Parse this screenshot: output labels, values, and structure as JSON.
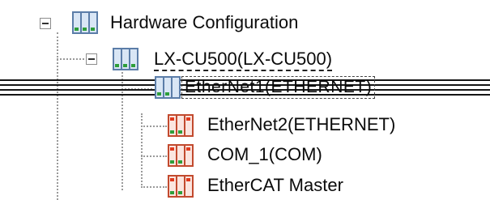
{
  "tree": {
    "root": {
      "label": "Hardware Configuration",
      "icon": "hardware-config-icon",
      "expanded": true
    },
    "controller": {
      "label": "LX-CU500(LX-CU500)",
      "icon": "controller-icon",
      "expanded": true
    },
    "children": [
      {
        "label": "EtherNet1(ETHERNET)",
        "icon": "ethernet-module-icon",
        "selected": true
      },
      {
        "label": "EtherNet2(ETHERNET)",
        "icon": "ethernet-module-icon"
      },
      {
        "label": "COM_1(COM)",
        "icon": "com-port-icon"
      },
      {
        "label": "EtherCAT Master",
        "icon": "ethercat-master-icon"
      }
    ]
  },
  "colors": {
    "icon_frame": "#5b7da8",
    "icon_fill": "#d9e6f5",
    "status_green": "#2e9e3a",
    "status_red": "#e03a1e",
    "connector": "#9a9a9a"
  }
}
